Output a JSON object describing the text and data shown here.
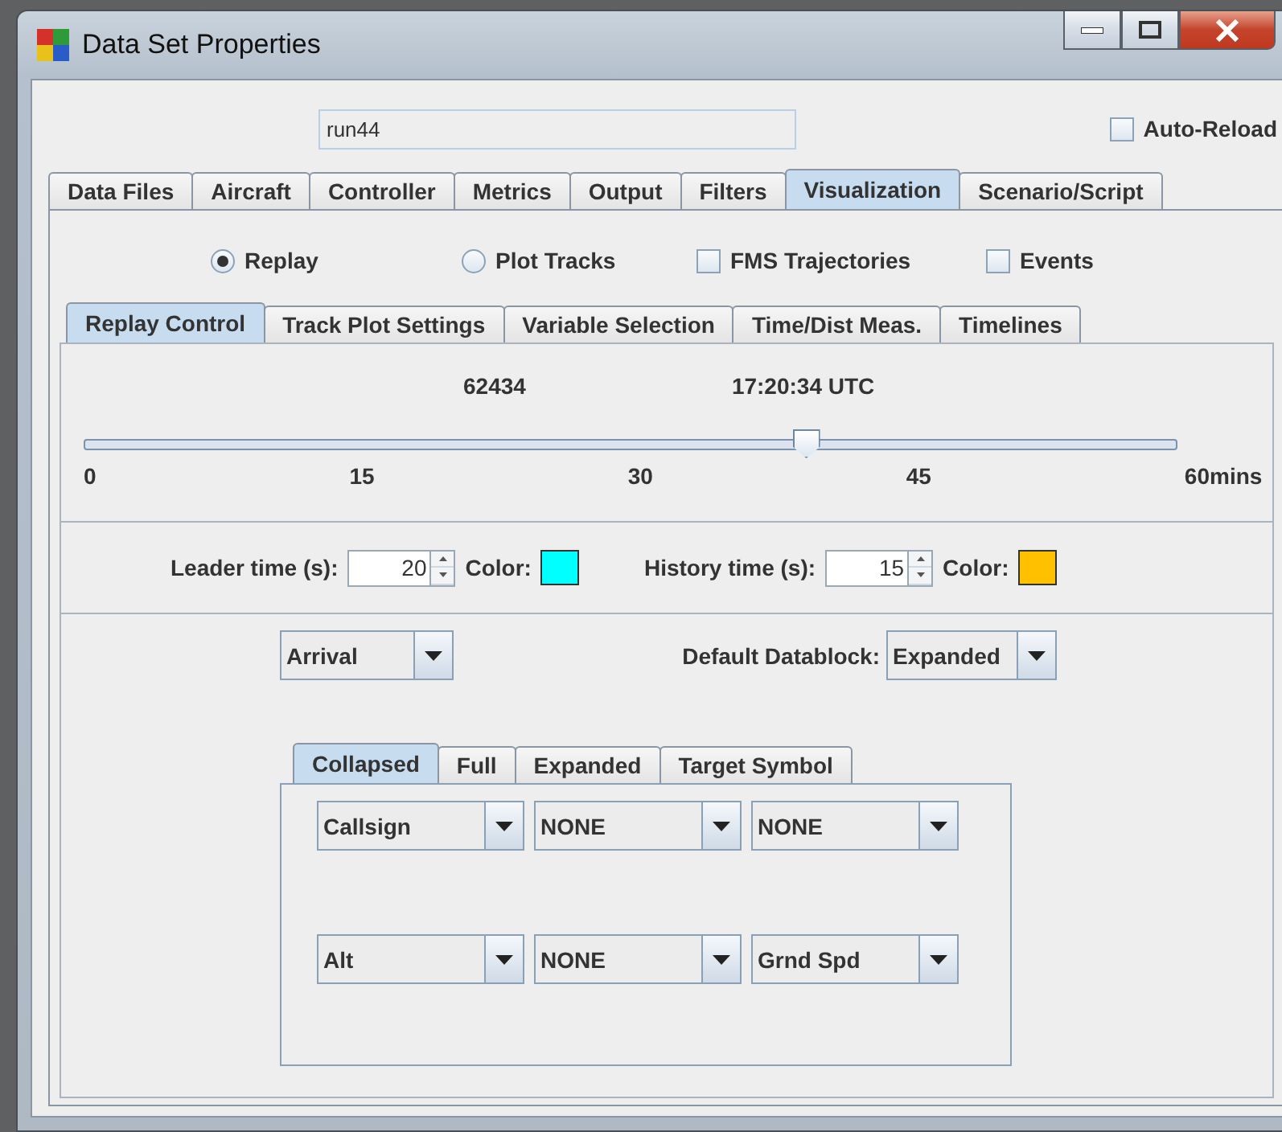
{
  "window": {
    "title": "Data Set Properties"
  },
  "dataset_name": {
    "value": "run44"
  },
  "auto_reload": {
    "label": "Auto-Reload",
    "checked": false
  },
  "tabs": [
    {
      "label": "Data Files",
      "selected": false
    },
    {
      "label": "Aircraft",
      "selected": false
    },
    {
      "label": "Controller",
      "selected": false
    },
    {
      "label": "Metrics",
      "selected": false
    },
    {
      "label": "Output",
      "selected": false
    },
    {
      "label": "Filters",
      "selected": false
    },
    {
      "label": "Visualization",
      "selected": true
    },
    {
      "label": "Scenario/Script",
      "selected": false
    }
  ],
  "modes": [
    {
      "kind": "radio",
      "label": "Replay",
      "checked": true
    },
    {
      "kind": "radio",
      "label": "Plot Tracks",
      "checked": false
    },
    {
      "kind": "checkbox",
      "label": "FMS Trajectories",
      "checked": false
    },
    {
      "kind": "checkbox",
      "label": "Events",
      "checked": false
    }
  ],
  "subtabs": [
    {
      "label": "Replay Control",
      "selected": true
    },
    {
      "label": "Track Plot Settings",
      "selected": false
    },
    {
      "label": "Variable Selection",
      "selected": false
    },
    {
      "label": "Time/Dist Meas.",
      "selected": false
    },
    {
      "label": "Timelines",
      "selected": false
    }
  ],
  "replay": {
    "frame": "62434",
    "time": "17:20:34 UTC",
    "slider": {
      "level": 0.66,
      "ticks": [
        "0",
        "15",
        "30",
        "45",
        "60"
      ],
      "unit": "mins"
    }
  },
  "leader": {
    "label": "Leader time (s):",
    "value": "20",
    "color_label": "Color:",
    "color": "#00ffff"
  },
  "history": {
    "label": "History time (s):",
    "value": "15",
    "color_label": "Color:",
    "color": "#ffc000"
  },
  "flight_type": {
    "value": "Arrival"
  },
  "default_datablock": {
    "label": "Default Datablock:",
    "value": "Expanded"
  },
  "datablock_tabs": [
    {
      "label": "Collapsed",
      "selected": true
    },
    {
      "label": "Full",
      "selected": false
    },
    {
      "label": "Expanded",
      "selected": false
    },
    {
      "label": "Target Symbol",
      "selected": false
    }
  ],
  "datablock_fields": [
    [
      {
        "value": "Callsign"
      },
      {
        "value": "NONE"
      },
      {
        "value": "NONE"
      }
    ],
    [
      {
        "value": "Alt"
      },
      {
        "value": "NONE"
      },
      {
        "value": "Grnd Spd"
      }
    ]
  ]
}
